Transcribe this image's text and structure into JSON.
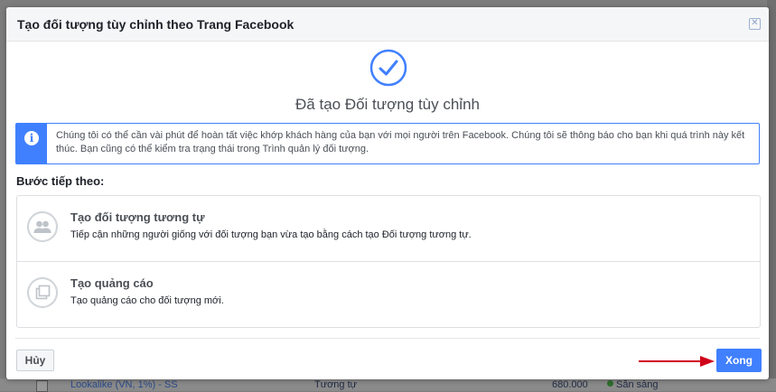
{
  "dialog": {
    "title": "Tạo đối tượng tùy chỉnh theo Trang Facebook",
    "close_icon": "close-icon",
    "success_icon": "check-circle-icon",
    "success_title": "Đã tạo Đối tượng tùy chỉnh",
    "info": {
      "icon": "info-icon",
      "text": "Chúng tôi có thể cần vài phút để hoàn tất việc khớp khách hàng của bạn với mọi người trên Facebook. Chúng tôi sẽ thông báo cho bạn khi quá trình này kết thúc. Bạn cũng có thể kiểm tra trạng thái trong Trình quản lý đối tượng."
    },
    "next_steps_label": "Bước tiếp theo:",
    "options": [
      {
        "icon": "people-icon",
        "title": "Tạo đối tượng tương tự",
        "description": "Tiếp cận những người giống với đối tượng bạn vừa tạo bằng cách tạo Đối tượng tương tự."
      },
      {
        "icon": "ad-icon",
        "title": "Tạo quảng cáo",
        "description": "Tạo quảng cáo cho đối tượng mới."
      }
    ],
    "cancel_label": "Hủy",
    "done_label": "Xong"
  },
  "background": {
    "row": {
      "name": "Lookalike (VN, 1%) - SS",
      "type": "Tương tự",
      "size": "680.000",
      "status": "Sẵn sàng"
    }
  },
  "colors": {
    "accent": "#4080ff",
    "annotation_arrow": "#d0021b"
  }
}
